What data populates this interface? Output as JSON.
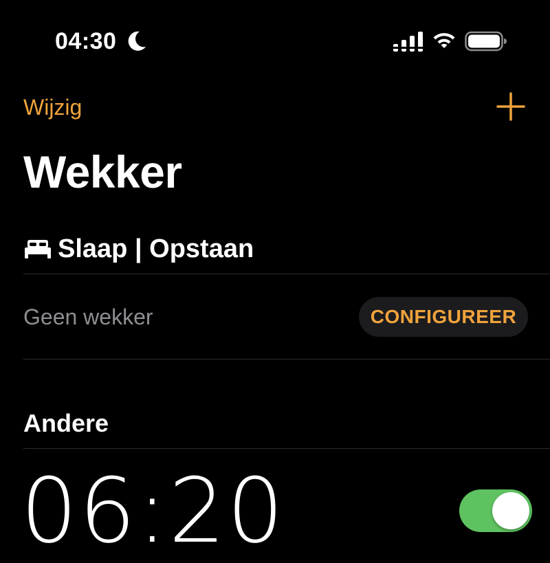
{
  "status_bar": {
    "time": "04:30",
    "focus_icon": "moon-icon",
    "cellular_icon": "cellular-signal-icon",
    "wifi_icon": "wifi-icon",
    "battery_icon": "battery-icon"
  },
  "nav": {
    "edit_label": "Wijzig",
    "add_icon": "plus-icon"
  },
  "title": "Wekker",
  "sleep": {
    "icon": "bed-icon",
    "title": "Slaap | Opstaan",
    "no_alarm_label": "Geen wekker",
    "configure_label": "CONFIGUREER"
  },
  "other": {
    "header": "Andere",
    "alarms": [
      {
        "time": "06:20",
        "enabled": true
      }
    ]
  },
  "colors": {
    "accent": "#f0a33c",
    "toggle_on": "#5fc260",
    "background": "#000000"
  }
}
